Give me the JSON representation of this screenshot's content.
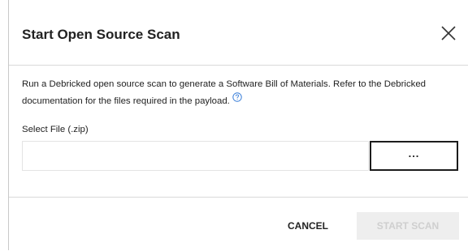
{
  "dialog": {
    "title": "Start Open Source Scan",
    "description": "Run a Debricked open source scan to generate a Software Bill of Materials. Refer to the Debricked documentation for the files required in the payload.",
    "help_icon": "question-circle-icon",
    "close_icon": "close-icon"
  },
  "file_select": {
    "label": "Select File (.zip)",
    "value": "",
    "browse_label": "..."
  },
  "footer": {
    "cancel_label": "CANCEL",
    "start_label": "START SCAN",
    "start_disabled": true
  },
  "colors": {
    "title_text": "#222222",
    "help_icon": "#3b7fd9",
    "disabled_button_bg": "#eeeeee",
    "disabled_button_text": "#cfcfcf",
    "border": "#d9d9d9"
  }
}
